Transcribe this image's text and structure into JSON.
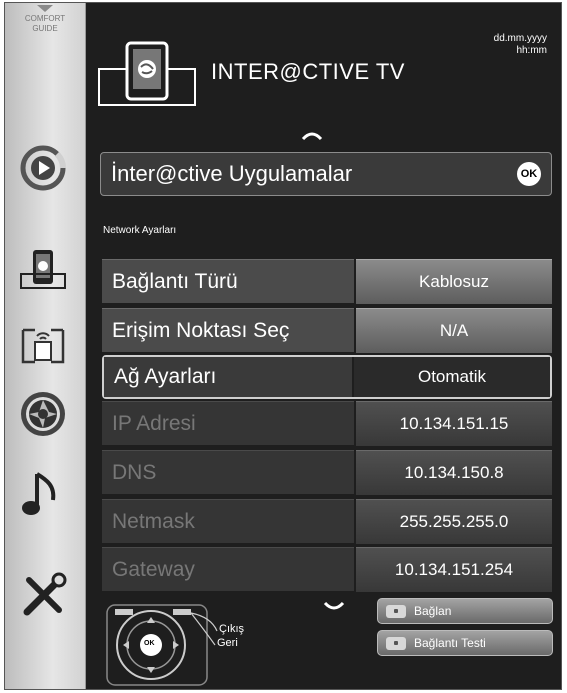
{
  "sidebar": {
    "comfort_guide": "COMFORT\nGUIDE",
    "icons": [
      "play-source-icon",
      "interactive-tv-icon",
      "media-share-icon",
      "photo-aperture-icon",
      "music-note-icon",
      "tools-icon"
    ]
  },
  "header": {
    "title": "INTER@CTIVE TV",
    "date": "dd.mm.yyyy",
    "time": "hh:mm"
  },
  "apps": {
    "label": "İnter@ctive Uygulamalar",
    "ok": "OK"
  },
  "section_label": "Network Ayarları",
  "rows": [
    {
      "name": "Bağlantı Türü",
      "value": "Kablosuz"
    },
    {
      "name": "Erişim Noktası Seç",
      "value": "N/A"
    },
    {
      "name": "Ağ Ayarları",
      "value": "Otomatik"
    },
    {
      "name": "IP Adresi",
      "value": "10.134.151.15"
    },
    {
      "name": "DNS",
      "value": "10.134.150.8"
    },
    {
      "name": "Netmask",
      "value": "255.255.255.0"
    },
    {
      "name": "Gateway",
      "value": "10.134.151.254"
    }
  ],
  "remote": {
    "ok": "OK",
    "exit": "Çıkış",
    "back": "Geri"
  },
  "buttons": {
    "connect": "Bağlan",
    "connection_test": "Bağlantı Testi"
  }
}
